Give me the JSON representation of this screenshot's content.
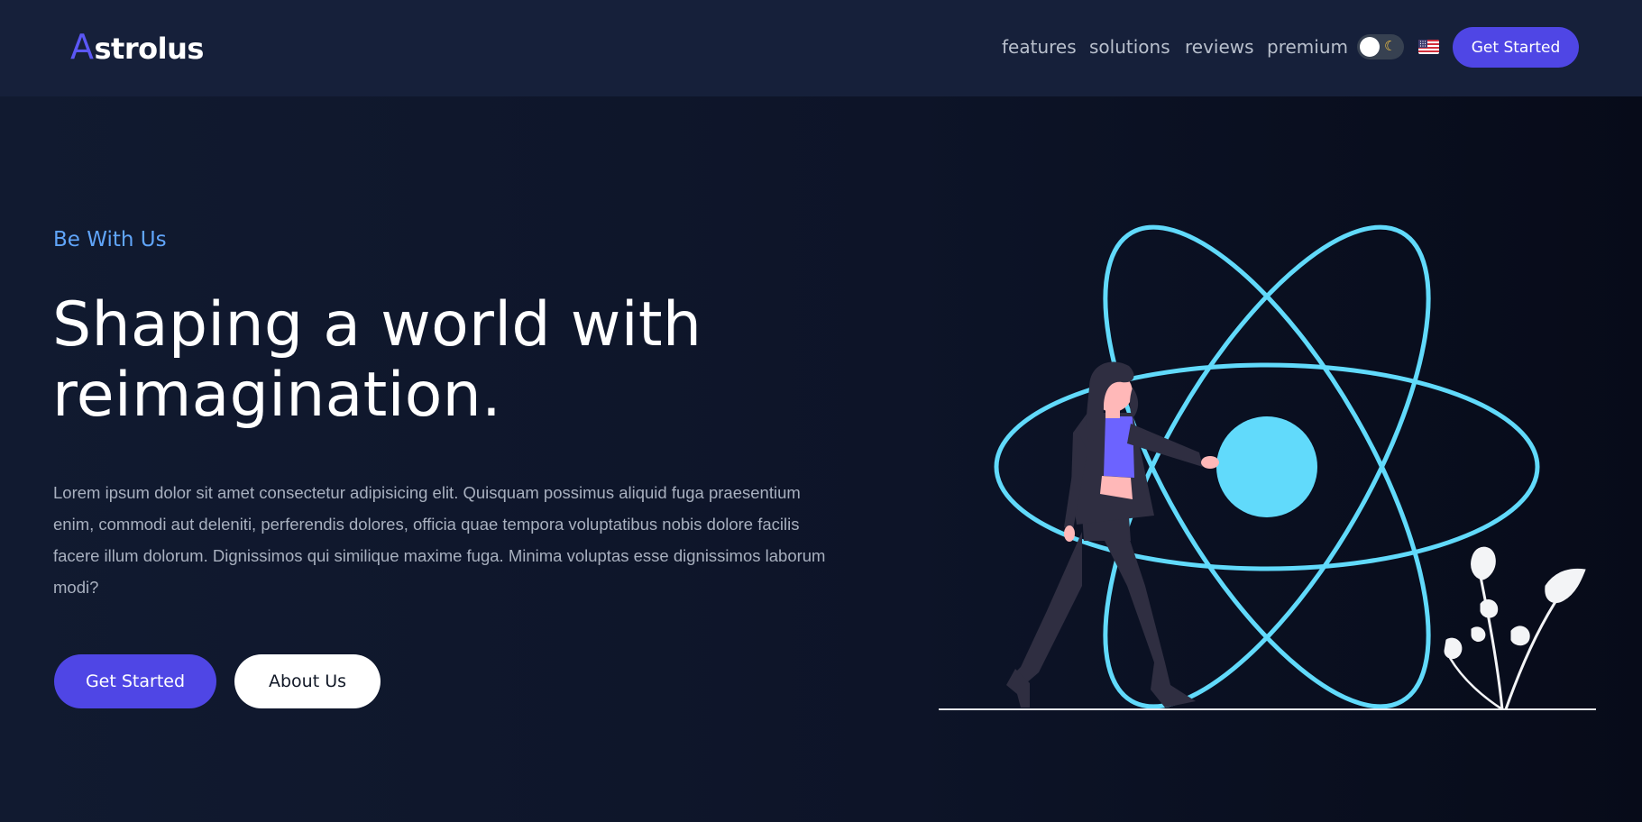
{
  "header": {
    "logo_letter": "A",
    "logo_rest": "strolus",
    "nav": [
      {
        "label": "features"
      },
      {
        "label": "solutions"
      },
      {
        "label": "reviews"
      },
      {
        "label": "premium"
      }
    ],
    "theme_toggle_icon": "moon-icon",
    "language_flag": "us-flag-icon",
    "cta_label": "Get Started"
  },
  "hero": {
    "eyebrow": "Be With Us",
    "headline_line1": "Shaping a world with",
    "headline_line2": "reimagination.",
    "body": "Lorem ipsum dolor sit amet consectetur adipisicing elit. Quisquam possimus aliquid fuga praesentium enim, commodi aut deleniti, perferendis dolores, officia quae tempora voluptatibus nobis dolore facilis facere illum dolorum. Dignissimos qui similique maxime fuga. Minima voluptas esse dignissimos laborum modi?",
    "primary_button": "Get Started",
    "secondary_button": "About Us"
  },
  "illustration": {
    "name": "woman-touching-atom-illustration",
    "atom_color": "#61dafb"
  },
  "colors": {
    "accent": "#4f46e5",
    "eyebrow": "#60a5fa",
    "header_bg": "#16203a",
    "page_bg": "#0f172a"
  }
}
